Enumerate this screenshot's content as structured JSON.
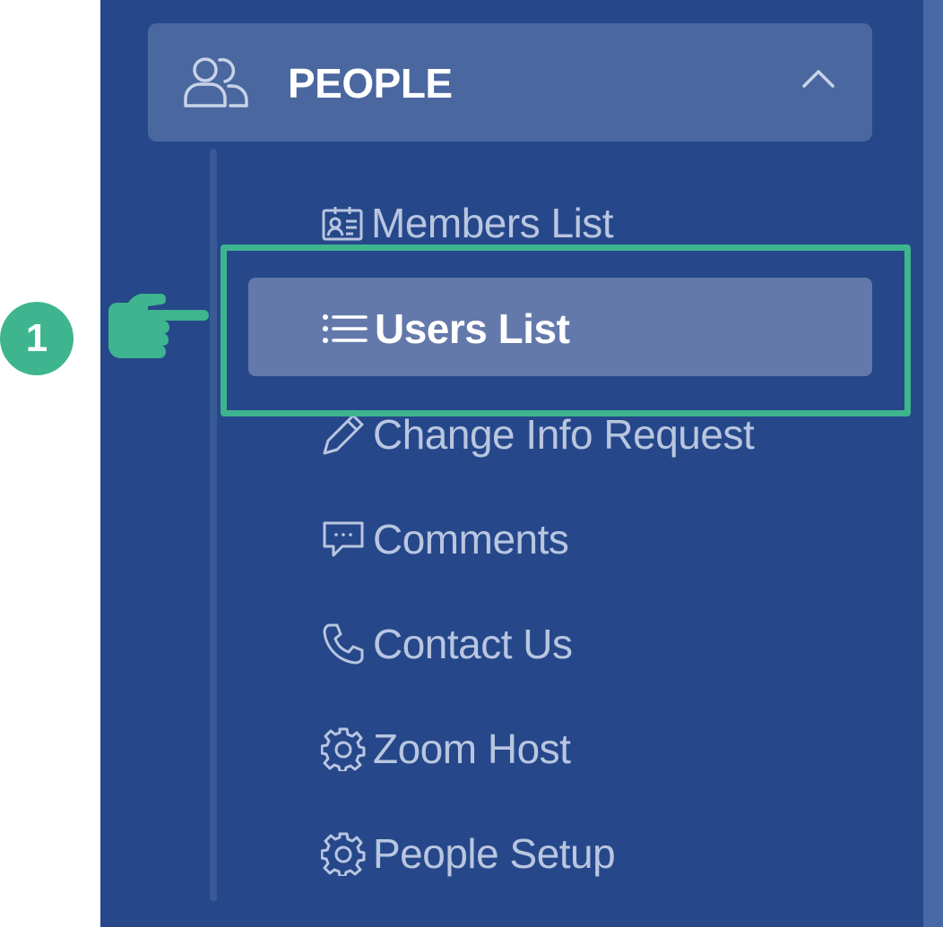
{
  "sidebar": {
    "group": {
      "label": "PEOPLE",
      "icon": "people-icon",
      "expanded": true
    },
    "items": [
      {
        "label": "Members List",
        "icon": "id-card-icon",
        "active": false
      },
      {
        "label": "Users List",
        "icon": "list-icon",
        "active": true
      },
      {
        "label": "Change Info Request",
        "icon": "pencil-icon",
        "active": false
      },
      {
        "label": "Comments",
        "icon": "comment-icon",
        "active": false
      },
      {
        "label": "Contact Us",
        "icon": "phone-icon",
        "active": false
      },
      {
        "label": "Zoom Host",
        "icon": "gear-icon",
        "active": false
      },
      {
        "label": "People Setup",
        "icon": "gear-icon",
        "active": false
      }
    ]
  },
  "annotation": {
    "step": "1",
    "color": "#3eb58e"
  },
  "colors": {
    "sidebar_bg": "#26488a",
    "header_bg": "#4a67a0",
    "active_bg": "#6479ab",
    "item_text": "#b9c6e0"
  }
}
